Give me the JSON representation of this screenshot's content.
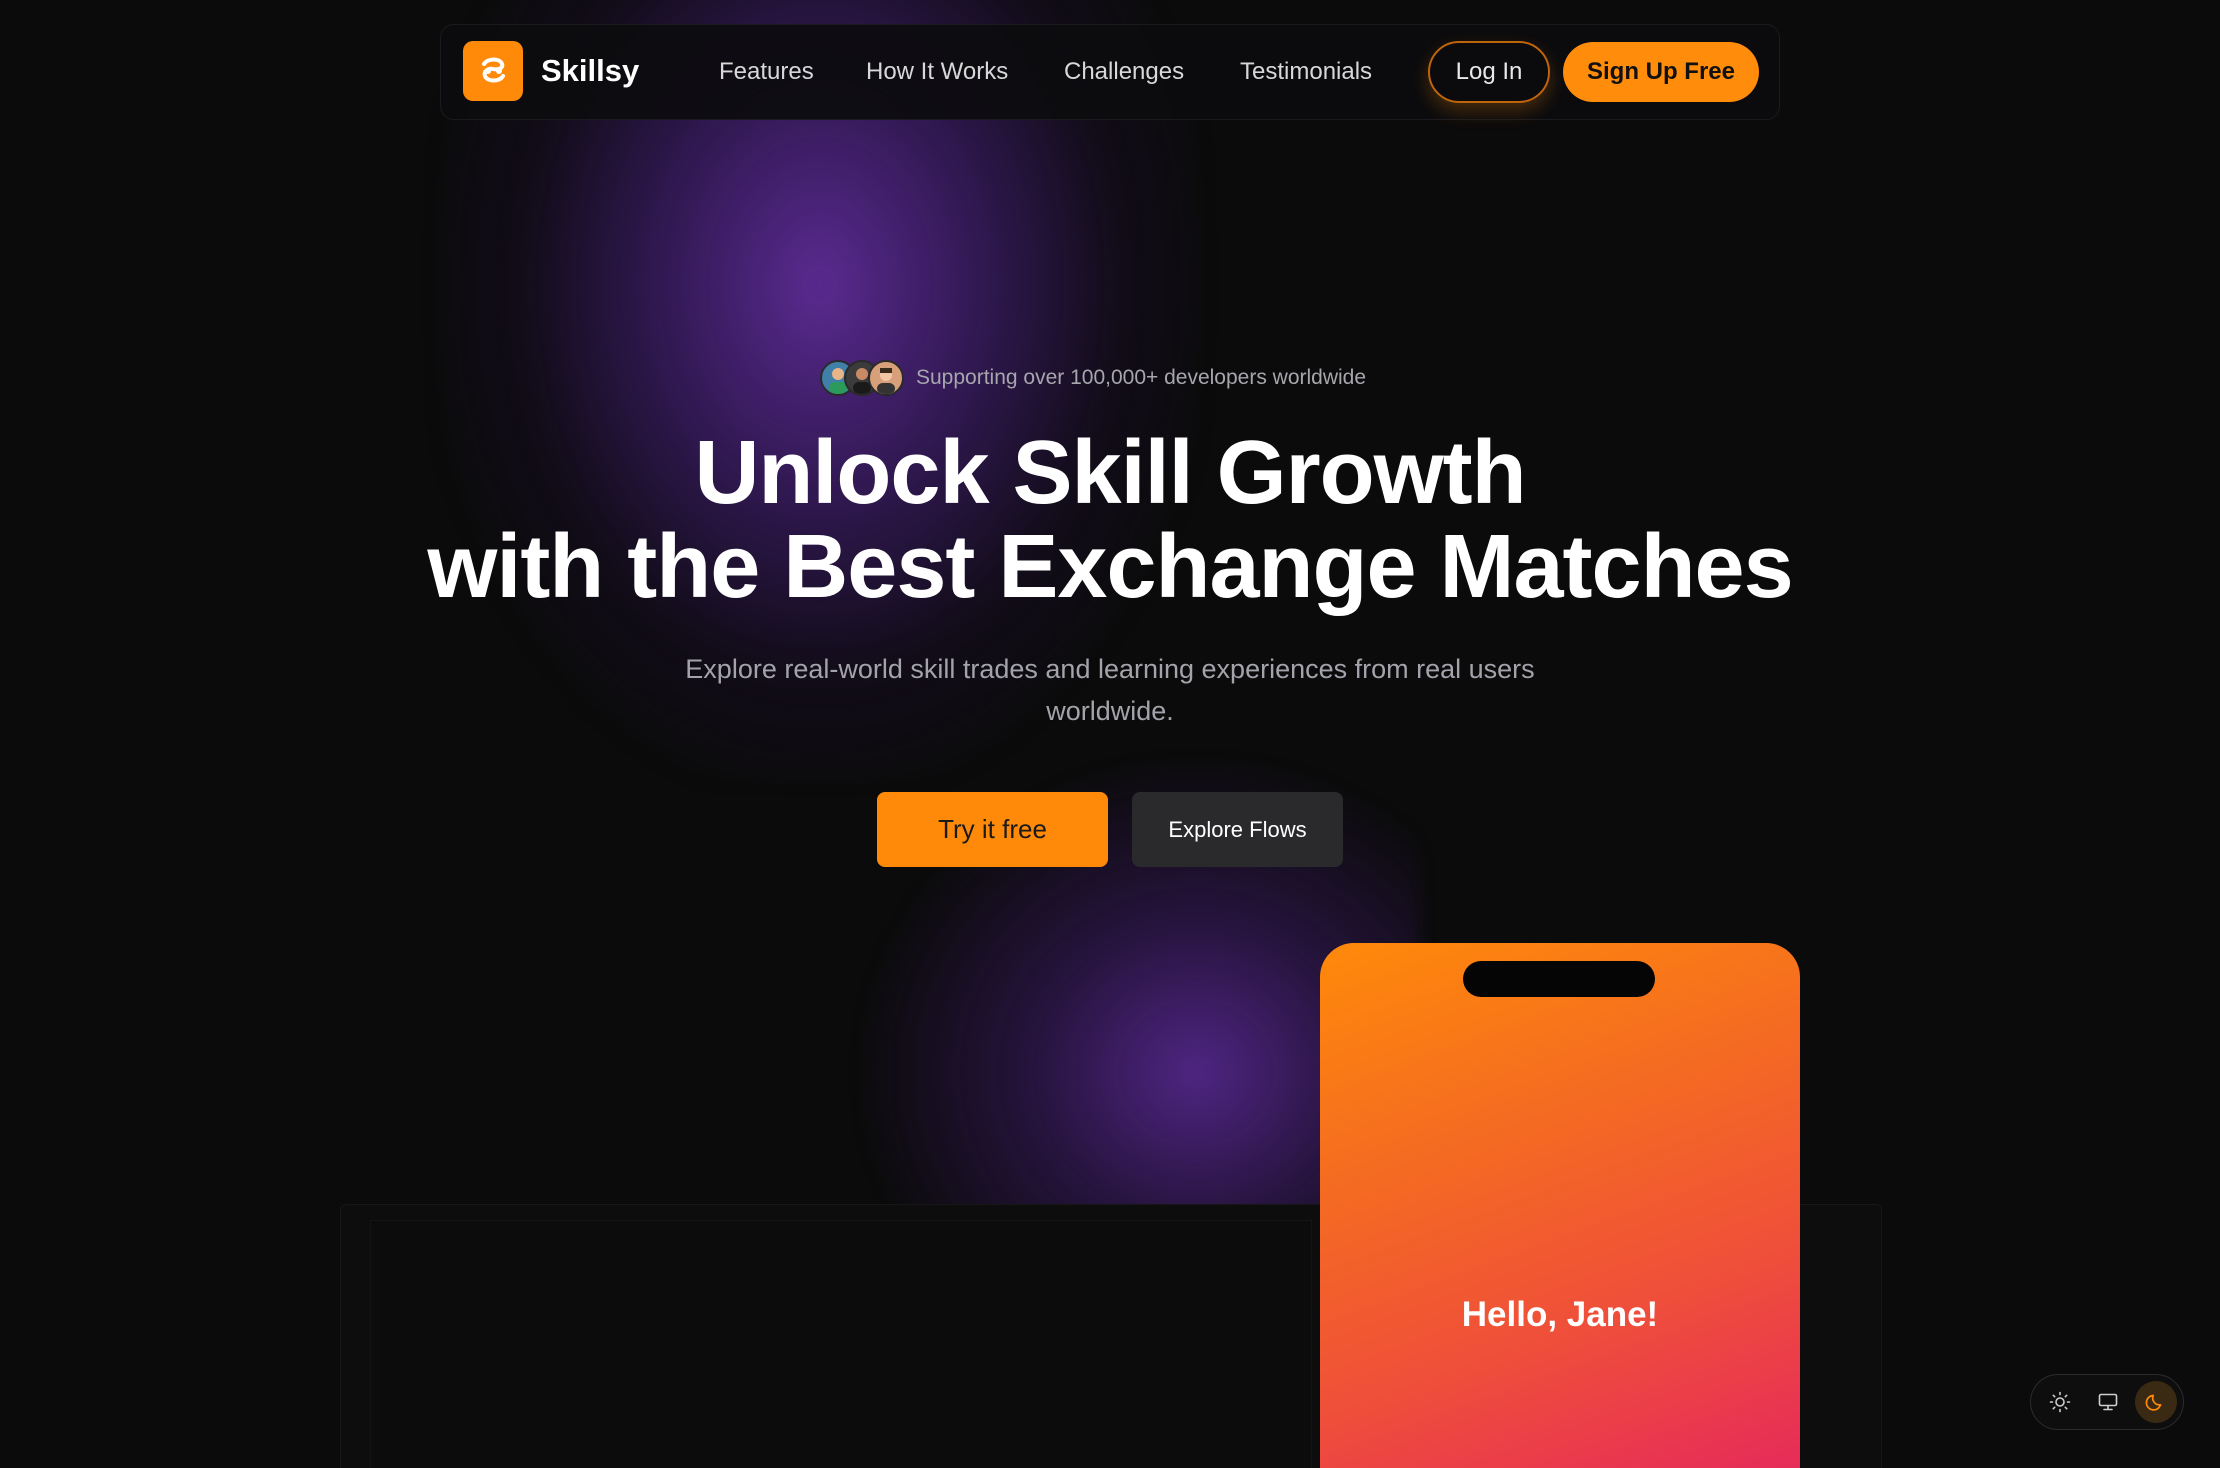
{
  "nav": {
    "brand": "Skillsy",
    "links": [
      "Features",
      "How It Works",
      "Challenges",
      "Testimonials"
    ],
    "login_label": "Log In",
    "signup_label": "Sign Up Free"
  },
  "hero": {
    "support_text": "Supporting over 100,000+ developers worldwide",
    "headline_line1": "Unlock Skill Growth",
    "headline_line2": "with the Best Exchange Matches",
    "subtext": "Explore real-world skill trades and learning experiences from real users worldwide.",
    "cta_primary": "Try it free",
    "cta_secondary": "Explore Flows"
  },
  "phone": {
    "greeting": "Hello, Jane!"
  },
  "theme_toggle": {
    "options": [
      "light-icon",
      "system-icon",
      "dark-icon"
    ],
    "selected": "dark"
  },
  "colors": {
    "accent": "#ff8a0a",
    "background": "#0b0b0b",
    "glow": "#5a2a9a"
  }
}
